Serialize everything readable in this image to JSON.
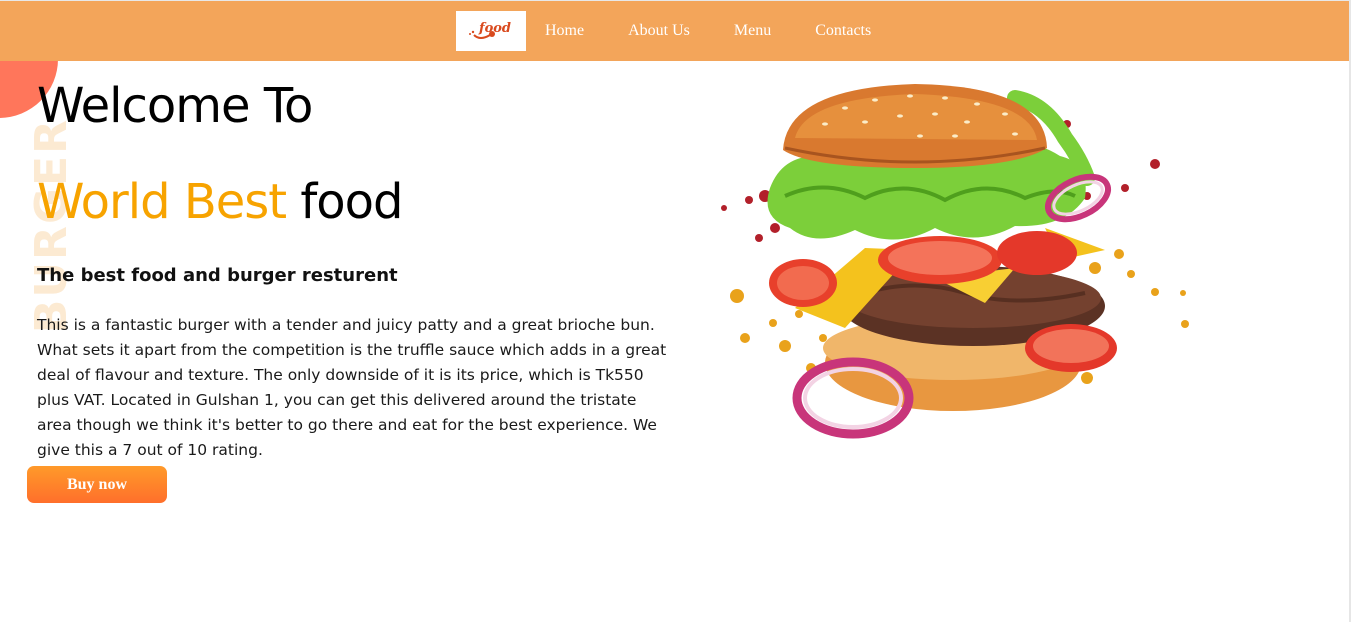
{
  "nav": {
    "logo_text": "food",
    "links": [
      "Home",
      "About Us",
      "Menu",
      "Contacts"
    ]
  },
  "hero": {
    "vertical_text": "BURGER",
    "line1": "Welcome To",
    "line2_accent": "World Best",
    "line2_rest": "food",
    "subtitle": "The best food and burger resturent",
    "description": "This is a fantastic burger with a tender and juicy patty and a great brioche bun. What sets it apart from the competition is the truffle sauce which adds in a great deal of flavour and texture. The only downside of it is its price, which is Tk550 plus VAT. Located in Gulshan 1, you can get this delivered around the tristate area though we think it's better to go there and eat for the best experience. We give this a 7 out of 10 rating.",
    "button_label": "Buy now"
  },
  "colors": {
    "navbar": "#f3a55a",
    "accent": "#f7a300",
    "button": "#ff8a2a"
  },
  "icons": {
    "logo": "food-logo-icon",
    "hero_image": "burger-image"
  }
}
